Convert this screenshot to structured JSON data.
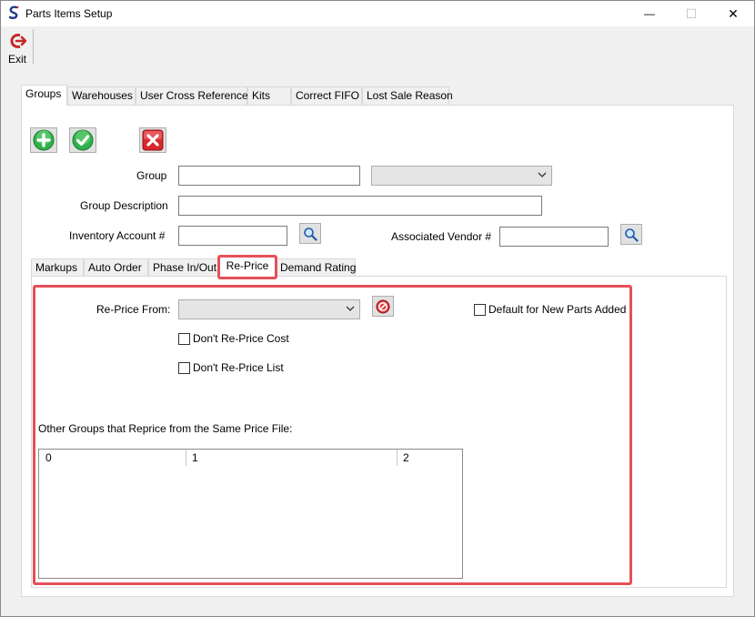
{
  "window": {
    "title": "Parts Items Setup",
    "minimize": "—",
    "maximize": "☐",
    "close": "✕"
  },
  "toolbar": {
    "exit_label": "Exit"
  },
  "main_tabs": [
    "Groups",
    "Warehouses",
    "User Cross Reference",
    "Kits",
    "Correct FIFO",
    "Lost Sale Reason"
  ],
  "groups_form": {
    "group_label": "Group",
    "group_value": "",
    "group_combo_value": "",
    "description_label": "Group Description",
    "description_value": "",
    "inventory_label": "Inventory Account #",
    "inventory_value": "",
    "vendor_label": "Associated Vendor #",
    "vendor_value": ""
  },
  "sub_tabs": [
    "Markups",
    "Auto Order",
    "Phase In/Out",
    "Re-Price",
    "Demand Rating"
  ],
  "reprice": {
    "reprice_from_label": "Re-Price From:",
    "reprice_from_value": "",
    "default_new_parts_label": "Default for New Parts Added",
    "dont_reprice_cost_label": "Don't Re-Price Cost",
    "dont_reprice_list_label": "Don't Re-Price List",
    "other_groups_label": "Other Groups that Reprice from the Same Price File:",
    "grid_columns": [
      "0",
      "1",
      "2"
    ]
  },
  "colors": {
    "highlight": "#e5505a",
    "add_green": "#2fb14a",
    "delete_red": "#d9272e"
  }
}
